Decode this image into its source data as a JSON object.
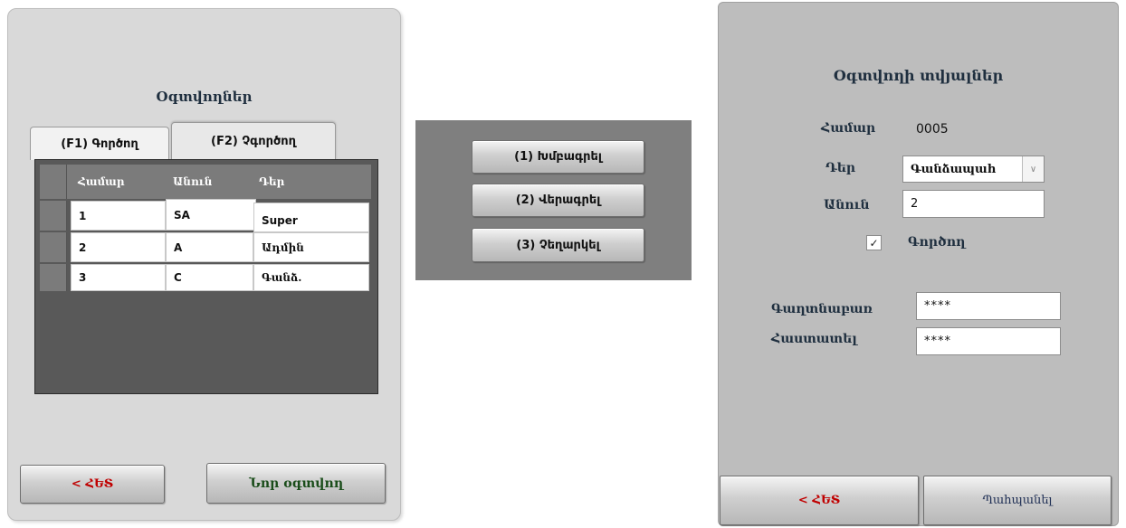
{
  "users_panel": {
    "title": "Օգտվողներ",
    "tabs": [
      "(F1) Գործող",
      "(F2) Չգործող"
    ],
    "columns": [
      "Համար",
      "Անուն",
      "Դեր"
    ],
    "rows": [
      {
        "num": "1",
        "name": "SA",
        "role": "Super"
      },
      {
        "num": "2",
        "name": "A",
        "role": "Ադմին"
      },
      {
        "num": "3",
        "name": "C",
        "role": "Գանձ."
      }
    ],
    "back_button": "< ՀԵՏ",
    "new_user_button": "Նոր օգտվող"
  },
  "menu_panel": {
    "items": [
      "(1) Խմբագրել",
      "(2) Վերագրել",
      "(3) Չեղարկել"
    ]
  },
  "user_details": {
    "title": "Օգտվողի տվյալներ",
    "number_label": "Համար",
    "number_value": "0005",
    "role_label": "Դեր",
    "role_value": "Գանձապահ",
    "name_label": "Անուն",
    "name_value": "2",
    "active_checked": true,
    "active_label": "Գործող",
    "password_label": "Գաղտնաբառ",
    "password_value": "****",
    "confirm_label": "Հաստատել",
    "confirm_value": "****",
    "back_button": "< ՀԵՏ",
    "save_button": "Պահպանել"
  }
}
